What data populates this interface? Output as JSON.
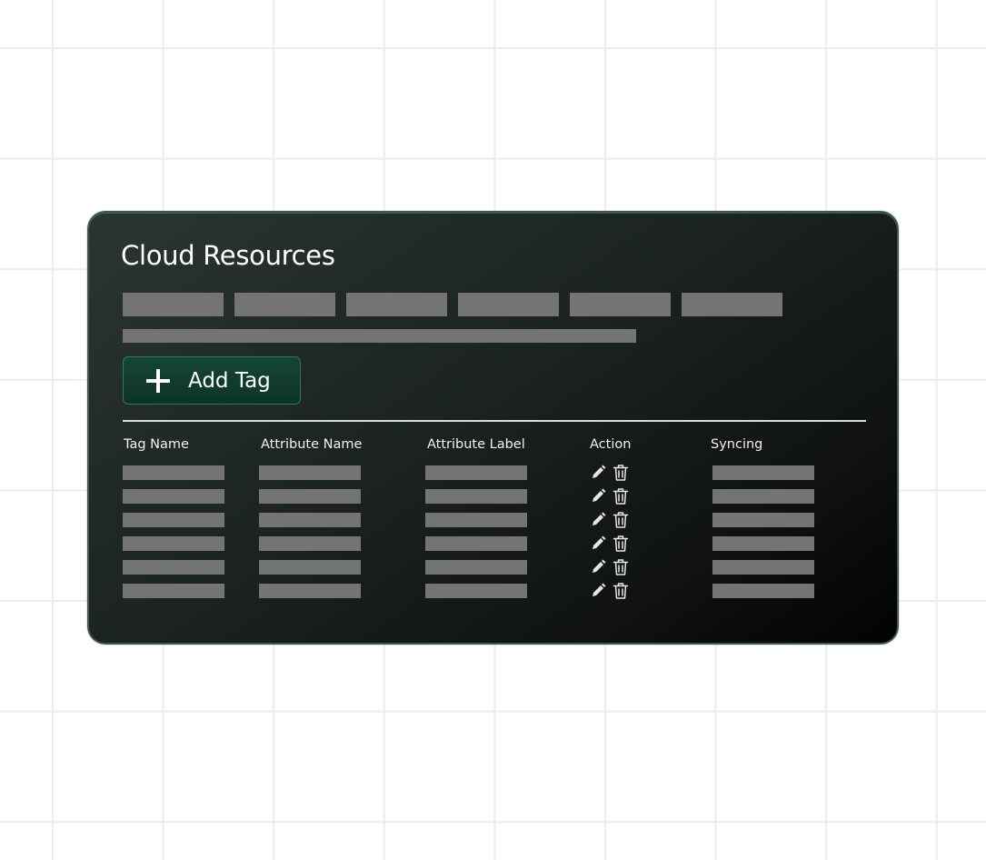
{
  "card": {
    "title": "Cloud Resources",
    "tab_placeholders": 6,
    "add_button_label": "Add Tag",
    "add_button_icon": "plus-icon"
  },
  "table": {
    "columns": [
      "Tag Name",
      "Attribute Name",
      "Attribute Label",
      "Action",
      "Syncing"
    ],
    "row_count": 6,
    "action_icons": [
      "pencil-icon",
      "trash-icon"
    ]
  },
  "colors": {
    "panel_background": "#1c2322",
    "panel_border": "#47524f",
    "button_background": "#134536",
    "button_border": "#2d7a5e",
    "placeholder_bar": "#747474",
    "text": "#ffffff",
    "grid_line": "#ececec"
  }
}
